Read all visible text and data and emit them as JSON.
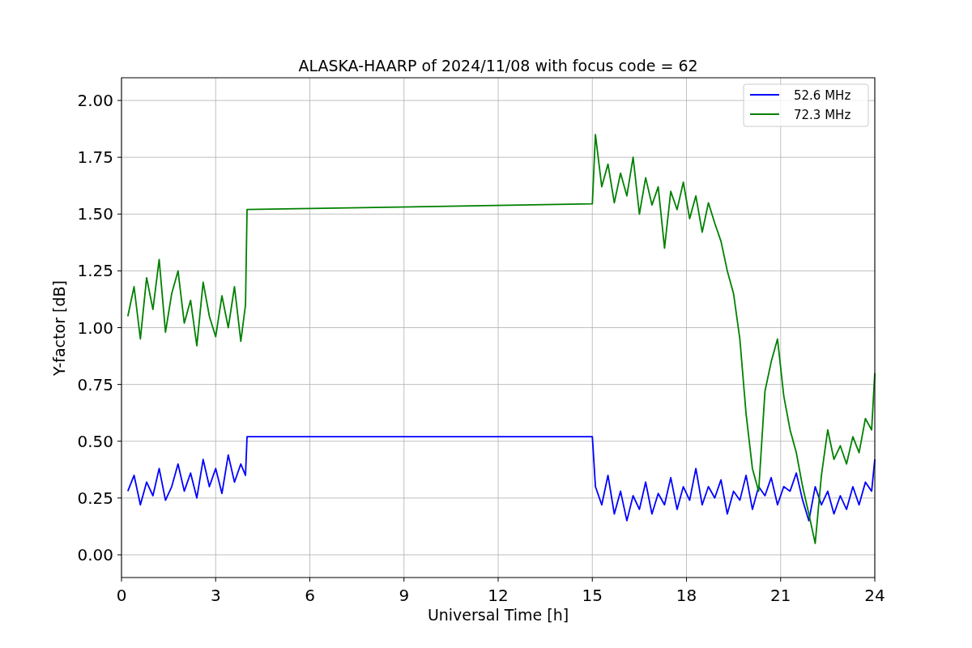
{
  "figure": {
    "chart_data": {
      "type": "line",
      "title": "ALASKA-HAARP of 2024/11/08 with focus code = 62",
      "xlabel": "Universal Time [h]",
      "ylabel": "Y-factor [dB]",
      "x": [
        0.2,
        0.4,
        0.6,
        0.8,
        1.0,
        1.2,
        1.4,
        1.6,
        1.8,
        2.0,
        2.2,
        2.4,
        2.6,
        2.8,
        3.0,
        3.2,
        3.4,
        3.6,
        3.8,
        3.95,
        4.0,
        15.0,
        15.1,
        15.3,
        15.5,
        15.7,
        15.9,
        16.1,
        16.3,
        16.5,
        16.7,
        16.9,
        17.1,
        17.3,
        17.5,
        17.7,
        17.9,
        18.1,
        18.3,
        18.5,
        18.7,
        18.9,
        19.1,
        19.3,
        19.5,
        19.7,
        19.9,
        20.1,
        20.3,
        20.5,
        20.7,
        20.9,
        21.1,
        21.3,
        21.5,
        21.7,
        21.9,
        22.1,
        22.3,
        22.5,
        22.7,
        22.9,
        23.1,
        23.3,
        23.5,
        23.7,
        23.9,
        24.0
      ],
      "series": [
        {
          "name": "52.6 MHz",
          "color": "#0000ff",
          "values": [
            0.28,
            0.35,
            0.22,
            0.32,
            0.26,
            0.38,
            0.24,
            0.3,
            0.4,
            0.28,
            0.36,
            0.25,
            0.42,
            0.3,
            0.38,
            0.27,
            0.44,
            0.32,
            0.4,
            0.35,
            0.52,
            0.52,
            0.3,
            0.22,
            0.35,
            0.18,
            0.28,
            0.15,
            0.26,
            0.2,
            0.32,
            0.18,
            0.27,
            0.22,
            0.34,
            0.2,
            0.3,
            0.24,
            0.38,
            0.22,
            0.3,
            0.25,
            0.33,
            0.18,
            0.28,
            0.24,
            0.35,
            0.2,
            0.3,
            0.26,
            0.34,
            0.22,
            0.3,
            0.28,
            0.36,
            0.24,
            0.15,
            0.3,
            0.22,
            0.28,
            0.18,
            0.26,
            0.2,
            0.3,
            0.22,
            0.32,
            0.28,
            0.42
          ]
        },
        {
          "name": "72.3 MHz",
          "color": "#008000",
          "values": [
            1.05,
            1.18,
            0.95,
            1.22,
            1.08,
            1.3,
            0.98,
            1.15,
            1.25,
            1.02,
            1.12,
            0.92,
            1.2,
            1.05,
            0.96,
            1.14,
            1.0,
            1.18,
            0.94,
            1.1,
            1.52,
            1.545,
            1.85,
            1.62,
            1.72,
            1.55,
            1.68,
            1.58,
            1.75,
            1.5,
            1.66,
            1.54,
            1.62,
            1.35,
            1.6,
            1.52,
            1.64,
            1.48,
            1.58,
            1.42,
            1.55,
            1.46,
            1.38,
            1.25,
            1.15,
            0.95,
            0.62,
            0.38,
            0.28,
            0.72,
            0.85,
            0.95,
            0.7,
            0.55,
            0.45,
            0.3,
            0.18,
            0.05,
            0.35,
            0.55,
            0.42,
            0.48,
            0.4,
            0.52,
            0.45,
            0.6,
            0.55,
            0.8
          ]
        }
      ],
      "grid": true,
      "legend": true,
      "xlim": [
        0,
        24
      ],
      "ylim": [
        -0.1,
        2.1
      ],
      "xticks": [
        0,
        3,
        6,
        9,
        12,
        15,
        18,
        21,
        24
      ],
      "yticks": [
        {
          "value": 0,
          "label": "0.00"
        },
        {
          "value": 0.25,
          "label": "0.25"
        },
        {
          "value": 0.5,
          "label": "0.50"
        },
        {
          "value": 0.75,
          "label": "0.75"
        },
        {
          "value": 1,
          "label": "1.00"
        },
        {
          "value": 1.25,
          "label": "1.25"
        },
        {
          "value": 1.5,
          "label": "1.50"
        },
        {
          "value": 1.75,
          "label": "1.75"
        },
        {
          "value": 2,
          "label": "2.00"
        }
      ]
    }
  }
}
